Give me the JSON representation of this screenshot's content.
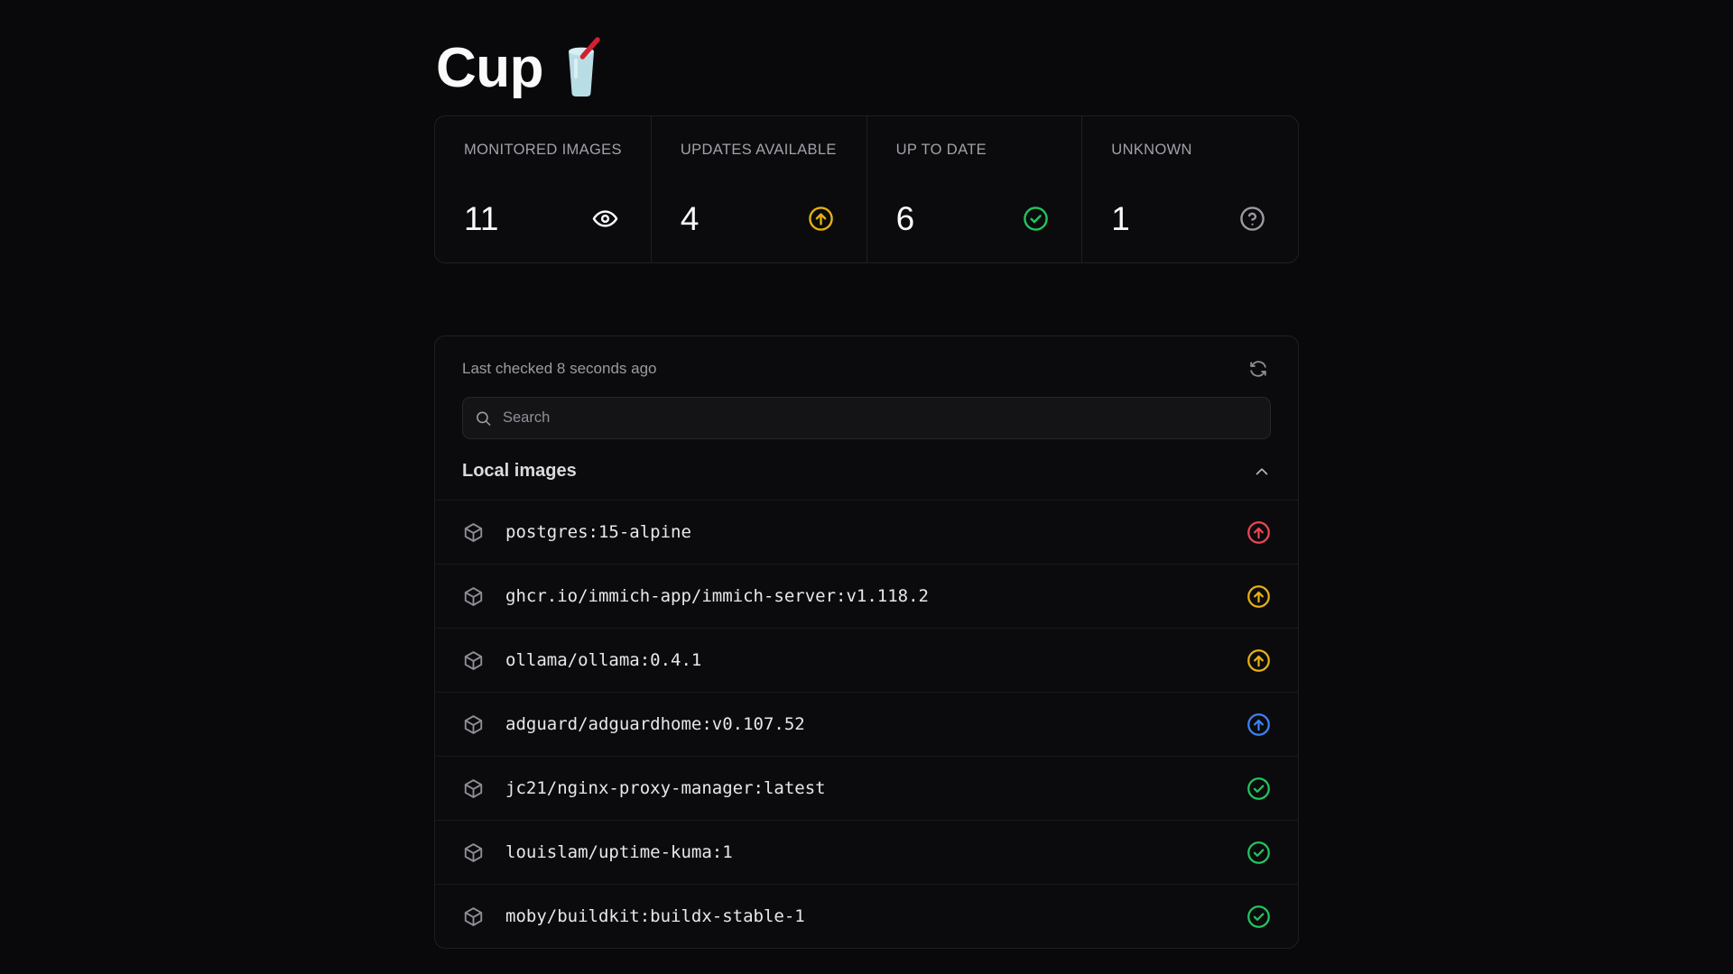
{
  "app": {
    "title": "Cup",
    "logo_icon": "cup-with-straw-emoji"
  },
  "stats": [
    {
      "label": "MONITORED IMAGES",
      "value": "11",
      "icon": "eye-icon",
      "color": "#ffffff"
    },
    {
      "label": "UPDATES AVAILABLE",
      "value": "4",
      "icon": "circle-arrow-up-icon",
      "color": "#e5b012"
    },
    {
      "label": "UP TO DATE",
      "value": "6",
      "icon": "circle-check-icon",
      "color": "#22c55e"
    },
    {
      "label": "UNKNOWN",
      "value": "1",
      "icon": "circle-question-icon",
      "color": "#9a9aa2"
    }
  ],
  "panel": {
    "last_checked": "Last checked 8 seconds ago",
    "refresh_icon": "refresh-icon",
    "search": {
      "placeholder": "Search",
      "value": "",
      "icon": "search-icon"
    },
    "group": {
      "title": "Local images",
      "expanded": true,
      "chevron_icon": "chevron-up-icon"
    },
    "images": [
      {
        "name": "postgres:15-alpine",
        "icon": "box-icon",
        "status": "update-major",
        "status_icon": "circle-arrow-up-icon",
        "status_color": "#ef4455"
      },
      {
        "name": "ghcr.io/immich-app/immich-server:v1.118.2",
        "icon": "box-icon",
        "status": "update-minor",
        "status_icon": "circle-arrow-up-icon",
        "status_color": "#e5b012"
      },
      {
        "name": "ollama/ollama:0.4.1",
        "icon": "box-icon",
        "status": "update-minor",
        "status_icon": "circle-arrow-up-icon",
        "status_color": "#e5b012"
      },
      {
        "name": "adguard/adguardhome:v0.107.52",
        "icon": "box-icon",
        "status": "update-patch",
        "status_icon": "circle-arrow-up-icon",
        "status_color": "#3b82f6"
      },
      {
        "name": "jc21/nginx-proxy-manager:latest",
        "icon": "box-icon",
        "status": "up-to-date",
        "status_icon": "circle-check-icon",
        "status_color": "#22c55e"
      },
      {
        "name": "louislam/uptime-kuma:1",
        "icon": "box-icon",
        "status": "up-to-date",
        "status_icon": "circle-check-icon",
        "status_color": "#22c55e"
      },
      {
        "name": "moby/buildkit:buildx-stable-1",
        "icon": "box-icon",
        "status": "up-to-date",
        "status_icon": "circle-check-icon",
        "status_color": "#22c55e"
      }
    ]
  },
  "colors": {
    "background": "#09090b",
    "panel": "#0b0b0d",
    "border": "#1f1f23",
    "text": "#fafafa",
    "muted": "#9a9aa2",
    "accent_yellow": "#e5b012",
    "accent_green": "#22c55e",
    "accent_red": "#ef4455",
    "accent_blue": "#3b82f6"
  }
}
